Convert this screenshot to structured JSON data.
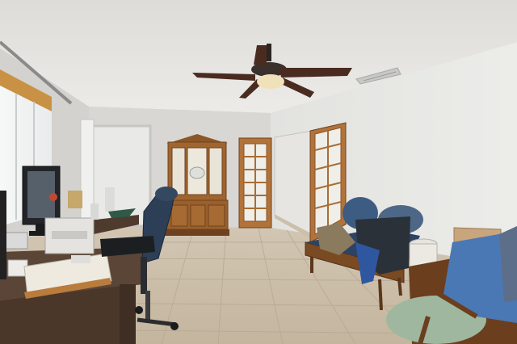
{
  "scene": {
    "kind": "room-interior-photo",
    "palette": {
      "ceiling": "#e4e3e0",
      "wall_left": "#d8d7d4",
      "wall_right": "#e6e6e3",
      "wall_back": "#dcdad6",
      "floor": "#c9bca8",
      "floor_grout": "#b7a993",
      "wood": "#a0652e",
      "wood_dark": "#6e4220",
      "chair_blue": "#2d3f57",
      "desk": "#5a4537",
      "glass": "#e8e4d8",
      "fan_blade": "#4a2b20",
      "fan_light": "#f0e2b8"
    }
  }
}
